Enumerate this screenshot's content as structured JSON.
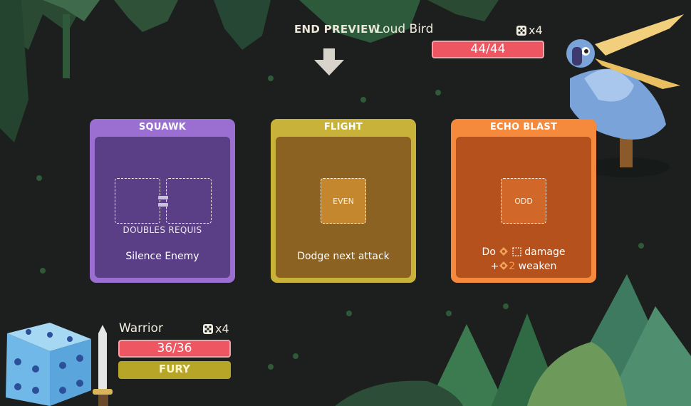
{
  "header": {
    "end_preview_label": "END PREVIEW"
  },
  "enemy": {
    "name": "Loud Bird",
    "dice_count": "x4",
    "hp": "44/44"
  },
  "cards": [
    {
      "title": "SQUAWK",
      "requirement": "DOUBLES REQUIS",
      "description": "Silence Enemy",
      "color": "#9a6fd1",
      "inner_color": "#5a3e86"
    },
    {
      "title": "FLIGHT",
      "slot_label": "EVEN",
      "description": "Dodge next attack",
      "color": "#c9b23a",
      "inner_color": "#8c6222"
    },
    {
      "title": "ECHO BLAST",
      "slot_label": "ODD",
      "description_do": "Do",
      "description_damage": "damage",
      "description_plus": "+",
      "description_num": "2",
      "description_weaken": "weaken",
      "color": "#f5893c",
      "inner_color": "#b4511c"
    }
  ],
  "player": {
    "name": "Warrior",
    "dice_count": "x4",
    "hp": "36/36",
    "status": "FURY"
  },
  "colors": {
    "hp_bar": "#ee5762",
    "status_bar": "#b7a528",
    "background": "#1c1f1d"
  },
  "icons": {
    "dice": "dice-icon",
    "arrow": "down-arrow-icon",
    "pip": "damage-pip-icon"
  }
}
